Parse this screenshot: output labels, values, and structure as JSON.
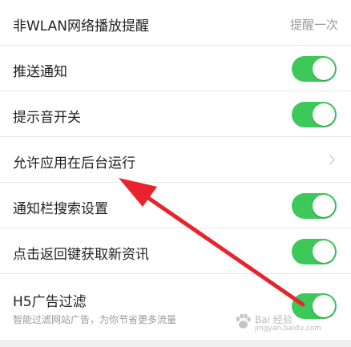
{
  "settings": {
    "items": [
      {
        "label": "非WLAN网络播放提醒",
        "value": "提醒一次",
        "control": "value"
      },
      {
        "label": "推送通知",
        "control": "toggle",
        "on": true
      },
      {
        "label": "提示音开关",
        "control": "toggle",
        "on": true
      },
      {
        "label": "允许应用在后台运行",
        "control": "chevron"
      },
      {
        "label": "通知栏搜索设置",
        "control": "toggle",
        "on": true
      },
      {
        "label": "点击返回键获取新资讯",
        "control": "toggle",
        "on": true
      },
      {
        "label": "H5广告过滤",
        "sublabel": "智能过滤网站广告，为你节省更多流量",
        "control": "toggle",
        "on": true
      }
    ]
  },
  "watermark": {
    "text": "Bai 经验",
    "url": "jingyan.baidu.com"
  },
  "colors": {
    "toggle_on": "#3cc95a",
    "arrow": "#e8232c",
    "divider": "#e8e8e8",
    "label": "#222222",
    "secondary": "#9a9a9a"
  }
}
